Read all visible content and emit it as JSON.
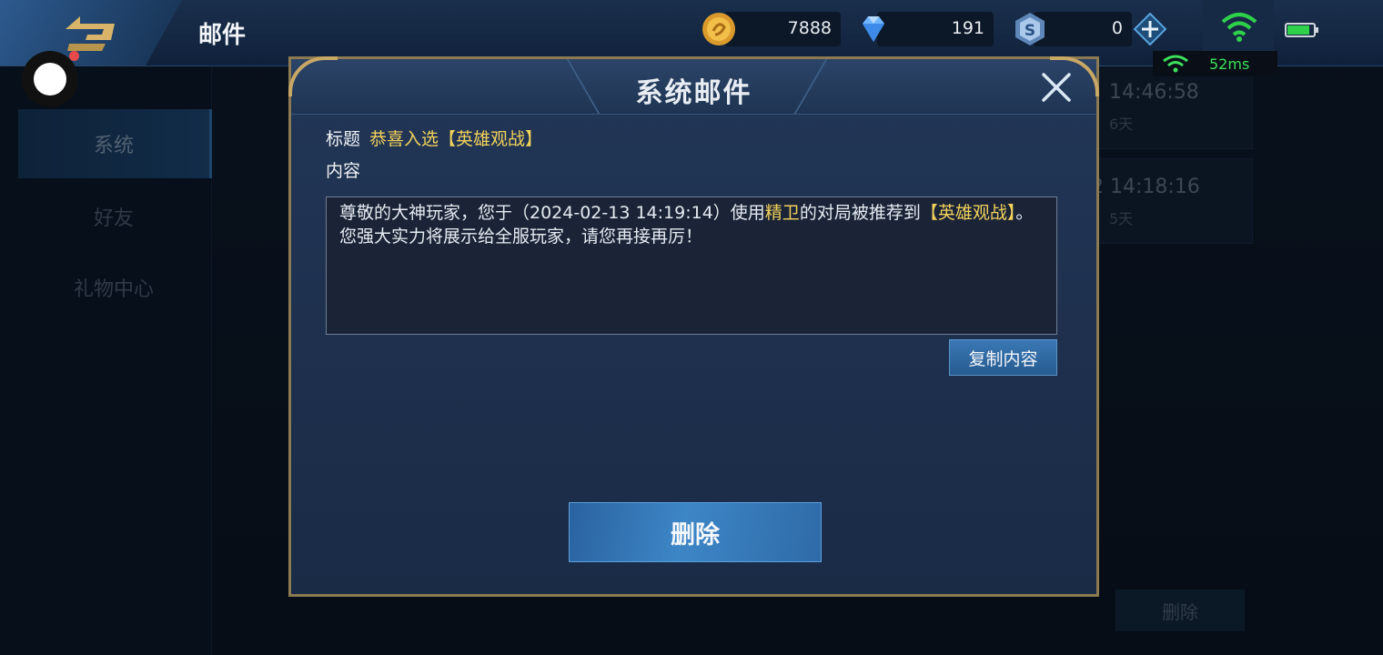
{
  "header": {
    "title": "邮件",
    "currencies": [
      {
        "name": "gold-coin",
        "value": "7888"
      },
      {
        "name": "diamond",
        "value": "191"
      },
      {
        "name": "s-coupon",
        "value": "0"
      }
    ],
    "ping": "52ms"
  },
  "sidebar": {
    "items": [
      {
        "label": "系统",
        "active": true
      },
      {
        "label": "好友",
        "active": false
      },
      {
        "label": "礼物中心",
        "active": false
      }
    ]
  },
  "mail_list": {
    "items": [
      {
        "time": "14:46:58",
        "age": "6天"
      },
      {
        "time": "2 14:18:16",
        "age": "5天"
      }
    ],
    "delete_label": "删除"
  },
  "dialog": {
    "title": "系统邮件",
    "subject_label": "标题",
    "subject_value": "恭喜入选【英雄观战】",
    "content_label": "内容",
    "content": {
      "part1": "尊敬的大神玩家，您于（2024-02-13 14:19:14）使用",
      "hero": "精卫",
      "part2": "的对局被推荐到",
      "tag": "【英雄观战】",
      "part3": "。",
      "line2": "您强大实力将展示给全服玩家，请您再接再厉！"
    },
    "copy_label": "复制内容",
    "delete_label": "删除"
  },
  "colors": {
    "highlight": "#f3d25a",
    "frame_gold": "#c9a866",
    "button_blue": "#3a78b4",
    "signal_green": "#3ce05b"
  }
}
